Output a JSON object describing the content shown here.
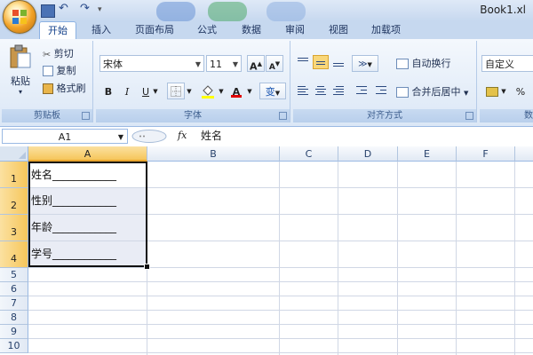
{
  "window": {
    "title": "Book1.xl"
  },
  "quick_access": {
    "undo": "↶",
    "redo": "↷",
    "customize": "▾"
  },
  "tabs": [
    {
      "label": "开始",
      "active": true
    },
    {
      "label": "插入"
    },
    {
      "label": "页面布局"
    },
    {
      "label": "公式"
    },
    {
      "label": "数据"
    },
    {
      "label": "审阅"
    },
    {
      "label": "视图"
    },
    {
      "label": "加载项"
    }
  ],
  "ribbon": {
    "clipboard": {
      "paste": "粘贴",
      "cut": "剪切",
      "copy": "复制",
      "format_painter": "格式刷",
      "label": "剪贴板"
    },
    "font": {
      "font_name": "宋体",
      "font_size": "11",
      "grow": "A",
      "shrink": "A",
      "bold": "B",
      "italic": "I",
      "underline": "U",
      "font_color_glyph": "A",
      "phonetic": "变",
      "label": "字体"
    },
    "alignment": {
      "wrap_text": "自动换行",
      "merge_center": "合并后居中",
      "label": "对齐方式"
    },
    "number": {
      "format": "自定义",
      "percent": "%",
      "label": "数字"
    }
  },
  "formula_bar": {
    "name_box": "A1",
    "fx": "fx",
    "content": "姓名"
  },
  "grid": {
    "columns": [
      "A",
      "B",
      "C",
      "D",
      "E",
      "F"
    ],
    "selected_column": "A",
    "rows": [
      "1",
      "2",
      "3",
      "4",
      "5",
      "6",
      "7",
      "8",
      "9",
      "10"
    ],
    "cells": [
      {
        "ref": "A1",
        "value": "姓名____________"
      },
      {
        "ref": "A2",
        "value": "性别____________"
      },
      {
        "ref": "A3",
        "value": "年龄____________"
      },
      {
        "ref": "A4",
        "value": "学号____________"
      }
    ]
  },
  "colors": {
    "selection_header": "#f6c65b",
    "ribbon_bg": "#dbe7f6",
    "accent": "#15428b"
  }
}
